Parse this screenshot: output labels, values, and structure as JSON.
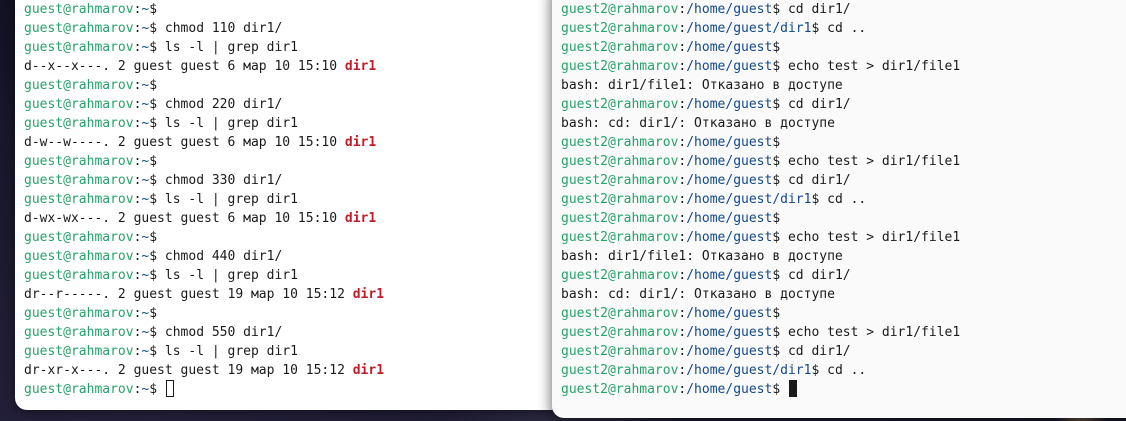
{
  "left_terminal": {
    "lines": [
      {
        "kind": "prompt",
        "user": "guest@rahmarov",
        "path": "~",
        "cmd": ""
      },
      {
        "kind": "prompt",
        "user": "guest@rahmarov",
        "path": "~",
        "cmd": "chmod 110 dir1/"
      },
      {
        "kind": "prompt",
        "user": "guest@rahmarov",
        "path": "~",
        "cmd": "ls -l | grep dir1"
      },
      {
        "kind": "listing",
        "text": "d--x--x---. 2 guest guest 6 мар 10 15:10 ",
        "hl": "dir1"
      },
      {
        "kind": "prompt",
        "user": "guest@rahmarov",
        "path": "~",
        "cmd": ""
      },
      {
        "kind": "prompt",
        "user": "guest@rahmarov",
        "path": "~",
        "cmd": "chmod 220 dir1/"
      },
      {
        "kind": "prompt",
        "user": "guest@rahmarov",
        "path": "~",
        "cmd": "ls -l | grep dir1"
      },
      {
        "kind": "listing",
        "text": "d-w--w----. 2 guest guest 6 мар 10 15:10 ",
        "hl": "dir1"
      },
      {
        "kind": "prompt",
        "user": "guest@rahmarov",
        "path": "~",
        "cmd": ""
      },
      {
        "kind": "prompt",
        "user": "guest@rahmarov",
        "path": "~",
        "cmd": "chmod 330 dir1/"
      },
      {
        "kind": "prompt",
        "user": "guest@rahmarov",
        "path": "~",
        "cmd": "ls -l | grep dir1"
      },
      {
        "kind": "listing",
        "text": "d-wx-wx---. 2 guest guest 6 мар 10 15:10 ",
        "hl": "dir1"
      },
      {
        "kind": "prompt",
        "user": "guest@rahmarov",
        "path": "~",
        "cmd": ""
      },
      {
        "kind": "prompt",
        "user": "guest@rahmarov",
        "path": "~",
        "cmd": "chmod 440 dir1/"
      },
      {
        "kind": "prompt",
        "user": "guest@rahmarov",
        "path": "~",
        "cmd": "ls -l | grep dir1"
      },
      {
        "kind": "listing",
        "text": "dr--r-----. 2 guest guest 19 мар 10 15:12 ",
        "hl": "dir1"
      },
      {
        "kind": "prompt",
        "user": "guest@rahmarov",
        "path": "~",
        "cmd": ""
      },
      {
        "kind": "prompt",
        "user": "guest@rahmarov",
        "path": "~",
        "cmd": "chmod 550 dir1/"
      },
      {
        "kind": "prompt",
        "user": "guest@rahmarov",
        "path": "~",
        "cmd": "ls -l | grep dir1"
      },
      {
        "kind": "listing",
        "text": "dr-xr-x---. 2 guest guest 19 мар 10 15:12 ",
        "hl": "dir1"
      },
      {
        "kind": "prompt",
        "user": "guest@rahmarov",
        "path": "~",
        "cmd": "",
        "cursor": "hollow"
      }
    ]
  },
  "right_terminal": {
    "lines": [
      {
        "kind": "prompt",
        "user": "guest2@rahmarov",
        "path": "/home/guest",
        "cmd": "cd dir1/"
      },
      {
        "kind": "prompt",
        "user": "guest2@rahmarov",
        "path": "/home/guest/dir1",
        "cmd": "cd .."
      },
      {
        "kind": "prompt",
        "user": "guest2@rahmarov",
        "path": "/home/guest",
        "cmd": ""
      },
      {
        "kind": "prompt",
        "user": "guest2@rahmarov",
        "path": "/home/guest",
        "cmd": "echo test > dir1/file1"
      },
      {
        "kind": "output",
        "text": "bash: dir1/file1: Отказано в доступе"
      },
      {
        "kind": "prompt",
        "user": "guest2@rahmarov",
        "path": "/home/guest",
        "cmd": "cd dir1/"
      },
      {
        "kind": "output",
        "text": "bash: cd: dir1/: Отказано в доступе"
      },
      {
        "kind": "prompt",
        "user": "guest2@rahmarov",
        "path": "/home/guest",
        "cmd": ""
      },
      {
        "kind": "prompt",
        "user": "guest2@rahmarov",
        "path": "/home/guest",
        "cmd": "echo test > dir1/file1"
      },
      {
        "kind": "prompt",
        "user": "guest2@rahmarov",
        "path": "/home/guest",
        "cmd": "cd dir1/"
      },
      {
        "kind": "prompt",
        "user": "guest2@rahmarov",
        "path": "/home/guest/dir1",
        "cmd": "cd .."
      },
      {
        "kind": "prompt",
        "user": "guest2@rahmarov",
        "path": "/home/guest",
        "cmd": ""
      },
      {
        "kind": "prompt",
        "user": "guest2@rahmarov",
        "path": "/home/guest",
        "cmd": "echo test > dir1/file1"
      },
      {
        "kind": "output",
        "text": "bash: dir1/file1: Отказано в доступе"
      },
      {
        "kind": "prompt",
        "user": "guest2@rahmarov",
        "path": "/home/guest",
        "cmd": "cd dir1/"
      },
      {
        "kind": "output",
        "text": "bash: cd: dir1/: Отказано в доступе"
      },
      {
        "kind": "prompt",
        "user": "guest2@rahmarov",
        "path": "/home/guest",
        "cmd": ""
      },
      {
        "kind": "prompt",
        "user": "guest2@rahmarov",
        "path": "/home/guest",
        "cmd": "echo test > dir1/file1"
      },
      {
        "kind": "prompt",
        "user": "guest2@rahmarov",
        "path": "/home/guest",
        "cmd": "cd dir1/"
      },
      {
        "kind": "prompt",
        "user": "guest2@rahmarov",
        "path": "/home/guest/dir1",
        "cmd": "cd .."
      },
      {
        "kind": "prompt",
        "user": "guest2@rahmarov",
        "path": "/home/guest",
        "cmd": "",
        "cursor": "solid"
      }
    ]
  },
  "colors": {
    "prompt_user": "#26a269",
    "prompt_path": "#12488b",
    "highlight": "#c01c28",
    "terminal_bg": "#ffffff",
    "text": "#1a1a1a"
  }
}
